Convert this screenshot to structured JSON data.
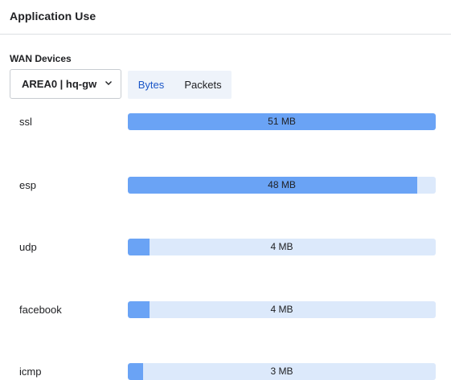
{
  "header": {
    "title": "Application Use"
  },
  "wan": {
    "label": "WAN Devices",
    "selected_device": "AREA0 | hq-gw"
  },
  "toggle": {
    "bytes_label": "Bytes",
    "packets_label": "Packets",
    "active": "Bytes"
  },
  "colors": {
    "accent": "#1a56c8",
    "bar_fill": "#6aa3f5",
    "bar_track": "#dce9fb"
  },
  "rows": [
    {
      "label": "ssl",
      "value_label": "51 MB",
      "fill_fraction": 1.0
    },
    {
      "label": "esp",
      "value_label": "48 MB",
      "fill_fraction": 0.94
    },
    {
      "label": "udp",
      "value_label": "4 MB",
      "fill_fraction": 0.07
    },
    {
      "label": "facebook",
      "value_label": "4 MB",
      "fill_fraction": 0.07
    },
    {
      "label": "icmp",
      "value_label": "3 MB",
      "fill_fraction": 0.05
    }
  ]
}
